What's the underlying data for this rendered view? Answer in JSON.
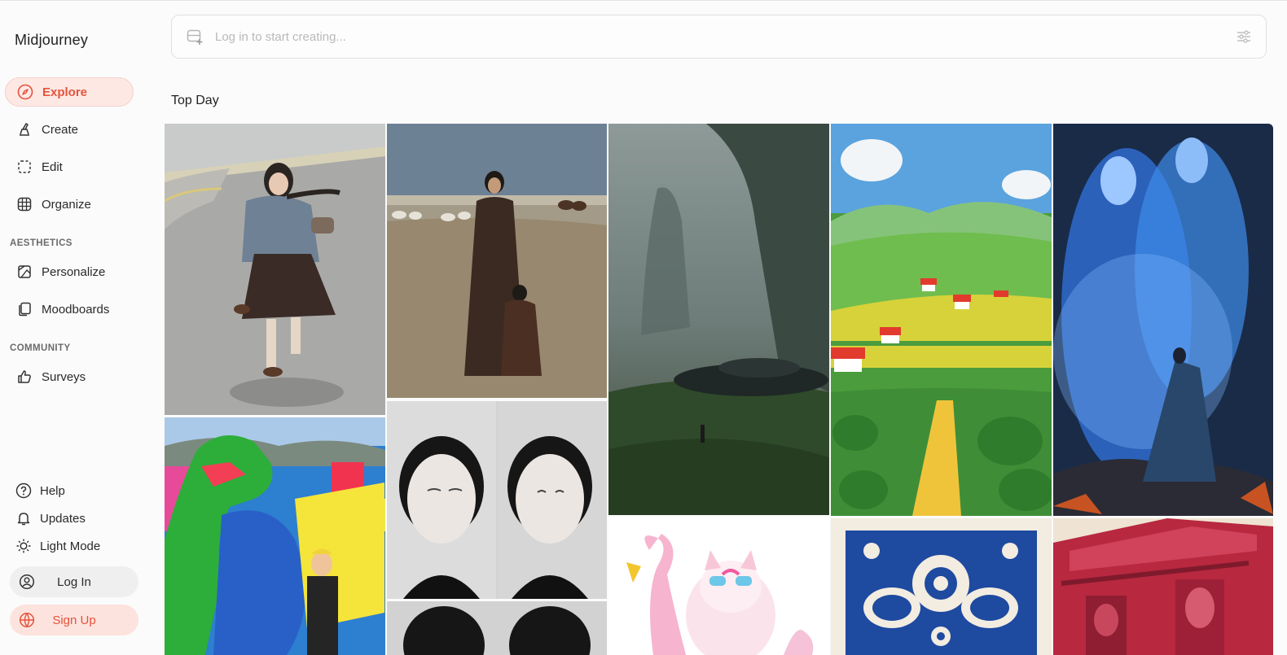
{
  "app": {
    "brand": "Midjourney"
  },
  "sidebar": {
    "nav": [
      {
        "label": "Explore",
        "icon": "compass-icon",
        "active": true
      },
      {
        "label": "Create",
        "icon": "brush-icon"
      },
      {
        "label": "Edit",
        "icon": "edit-frame-icon"
      },
      {
        "label": "Organize",
        "icon": "grid-icon"
      }
    ],
    "aesthetics_label": "AESTHETICS",
    "aesthetics": [
      {
        "label": "Personalize",
        "icon": "personalize-icon"
      },
      {
        "label": "Moodboards",
        "icon": "moodboard-icon"
      }
    ],
    "community_label": "COMMUNITY",
    "community": [
      {
        "label": "Surveys",
        "icon": "thumbs-up-icon"
      }
    ],
    "footer": [
      {
        "label": "Help",
        "icon": "help-icon"
      },
      {
        "label": "Updates",
        "icon": "bell-icon"
      },
      {
        "label": "Light Mode",
        "icon": "sun-icon"
      }
    ],
    "login_label": "Log In",
    "signup_label": "Sign Up"
  },
  "search": {
    "placeholder": "Log in to start creating..."
  },
  "feed": {
    "title": "Top Day",
    "images": [
      {
        "subject": "girl-running-street"
      },
      {
        "subject": "woman-child-field-sheep"
      },
      {
        "subject": "misty-cliffs-spaceship"
      },
      {
        "subject": "painted-village-fields"
      },
      {
        "subject": "blue-ethereal-figures"
      },
      {
        "subject": "green-monster-city"
      },
      {
        "subject": "black-white-faces"
      },
      {
        "subject": "flamingo-cat"
      },
      {
        "subject": "blue-folk-birds-pattern"
      },
      {
        "subject": "red-ornate-building"
      }
    ]
  },
  "colors": {
    "accent": "#e5533d",
    "accent_bg": "#fde8e4"
  }
}
